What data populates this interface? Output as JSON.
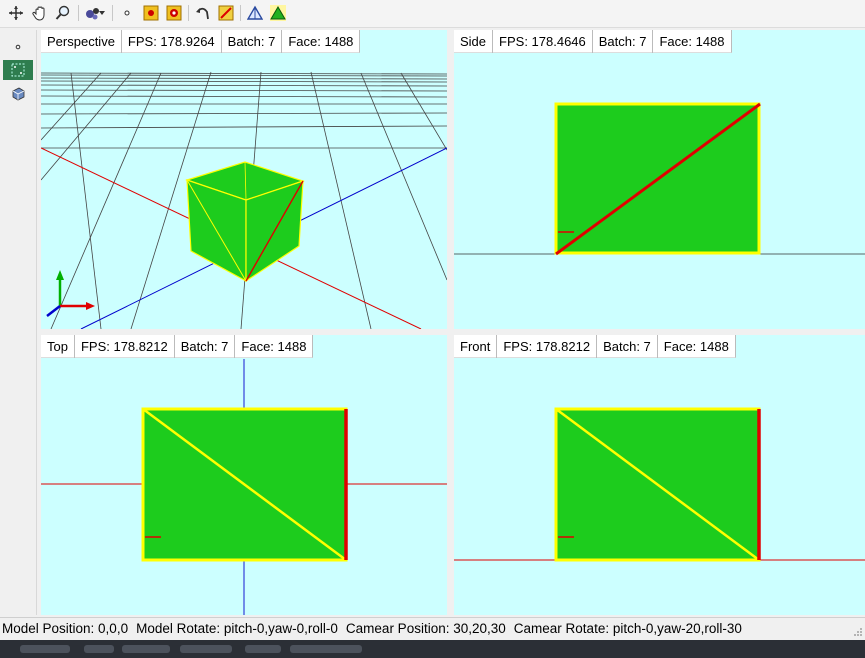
{
  "toolbar": {
    "icons": [
      "move-icon",
      "hand-pan-icon",
      "zoom-icon",
      "render-mode-icon",
      "chevron-down-icon",
      "point-icon",
      "vertex-icon",
      "face-icon",
      "rotate-icon",
      "edge-icon",
      "triangle-outline-icon",
      "triangle-fill-icon"
    ]
  },
  "sidebar": {
    "icons": [
      "point-mode-icon",
      "grid-select-icon",
      "object-icon"
    ]
  },
  "viewports": {
    "perspective": {
      "name": "Perspective",
      "fps": "FPS: 178.9264",
      "batch": "Batch: 7",
      "face": "Face: 1488"
    },
    "side": {
      "name": "Side",
      "fps": "FPS: 178.4646",
      "batch": "Batch: 7",
      "face": "Face: 1488"
    },
    "top": {
      "name": "Top",
      "fps": "FPS: 178.8212",
      "batch": "Batch: 7",
      "face": "Face: 1488"
    },
    "front": {
      "name": "Front",
      "fps": "FPS: 178.8212",
      "batch": "Batch: 7",
      "face": "Face: 1488"
    }
  },
  "status": {
    "model_position": "Model Position: 0,0,0",
    "model_rotate": "Model Rotate: pitch-0,yaw-0,roll-0",
    "camera_position": "Camear Position: 30,20,30",
    "camera_rotate": "Camear Rotate: pitch-0,yaw-20,roll-30"
  },
  "colors": {
    "viewport_bg": "#ccffff",
    "face_green": "#1dcc1d",
    "edge_yellow": "#ffff00",
    "axis_red": "#e00000",
    "axis_blue": "#0000cc"
  }
}
